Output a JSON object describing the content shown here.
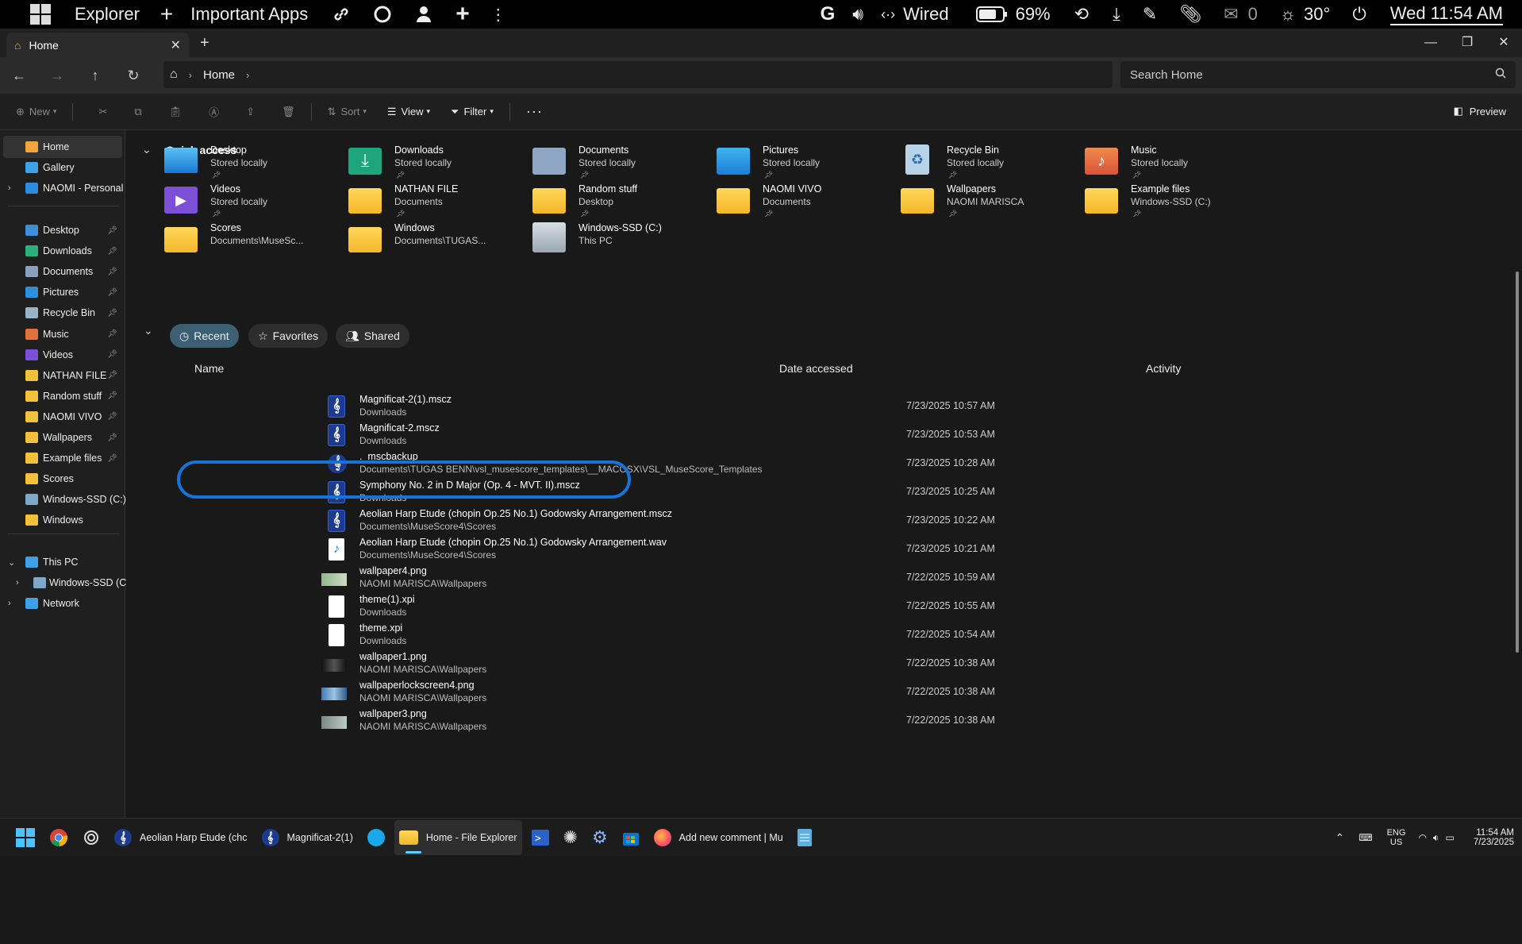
{
  "topbar": {
    "app_name": "Explorer",
    "pinned_label": "Important Apps",
    "network": "Wired",
    "battery": "69%",
    "mail_count": "0",
    "temperature": "30°",
    "clock": "Wed 11:54 AM"
  },
  "window": {
    "tab_title": "Home"
  },
  "address": {
    "crumb": "Home",
    "search_placeholder": "Search Home"
  },
  "toolbar": {
    "new": "New",
    "sort": "Sort",
    "view": "View",
    "filter": "Filter",
    "preview": "Preview"
  },
  "sidebar": {
    "top": [
      {
        "label": "Home"
      },
      {
        "label": "Gallery"
      },
      {
        "label": "NAOMI - Personal"
      }
    ],
    "pinned": [
      {
        "label": "Desktop",
        "color": "#3b8ed8"
      },
      {
        "label": "Downloads",
        "color": "#2bb07a"
      },
      {
        "label": "Documents",
        "color": "#8aa0c0"
      },
      {
        "label": "Pictures",
        "color": "#2c8fe0"
      },
      {
        "label": "Recycle Bin",
        "color": "#9ab3c8"
      },
      {
        "label": "Music",
        "color": "#e2703c"
      },
      {
        "label": "Videos",
        "color": "#7b4fd6"
      },
      {
        "label": "NATHAN FILE",
        "color": "#f3c03c"
      },
      {
        "label": "Random stuff",
        "color": "#f3c03c"
      },
      {
        "label": "NAOMI VIVO",
        "color": "#f3c03c"
      },
      {
        "label": "Wallpapers",
        "color": "#f3c03c"
      },
      {
        "label": "Example files",
        "color": "#f3c03c"
      },
      {
        "label": "Scores",
        "color": "#f3c03c"
      },
      {
        "label": "Windows-SSD (C:)",
        "color": "#7fa8c8"
      },
      {
        "label": "Windows",
        "color": "#f3c03c"
      }
    ],
    "bottom": [
      {
        "label": "This PC"
      },
      {
        "label": "Windows-SSD (C:)"
      },
      {
        "label": "Network"
      }
    ]
  },
  "quick_access": {
    "title": "Quick access",
    "items": [
      {
        "name": "Desktop",
        "sub": "Stored locally",
        "icon": "desktop-icon"
      },
      {
        "name": "Downloads",
        "sub": "Stored locally",
        "icon": "downloads-icon"
      },
      {
        "name": "Documents",
        "sub": "Stored locally",
        "icon": "documents-icon"
      },
      {
        "name": "Pictures",
        "sub": "Stored locally",
        "icon": "pictures-icon"
      },
      {
        "name": "Recycle Bin",
        "sub": "Stored locally",
        "icon": "recycle-bin-icon"
      },
      {
        "name": "Music",
        "sub": "Stored locally",
        "icon": "music-icon"
      },
      {
        "name": "Videos",
        "sub": "Stored locally",
        "icon": "videos-icon"
      },
      {
        "name": "NATHAN FILE",
        "sub": "Documents",
        "icon": "folder-icon"
      },
      {
        "name": "Random stuff",
        "sub": "Desktop",
        "icon": "folder-icon"
      },
      {
        "name": "NAOMI VIVO",
        "sub": "Documents",
        "icon": "folder-icon"
      },
      {
        "name": "Wallpapers",
        "sub": "NAOMI MARISCA",
        "icon": "folder-icon"
      },
      {
        "name": "Example files",
        "sub": "Windows-SSD (C:)",
        "icon": "folder-icon"
      },
      {
        "name": "Scores",
        "sub": "Documents\\MuseSc...",
        "icon": "folder-icon"
      },
      {
        "name": "Windows",
        "sub": "Documents\\TUGAS...",
        "icon": "folder-icon"
      },
      {
        "name": "Windows-SSD (C:)",
        "sub": "This PC",
        "icon": "drive-icon"
      }
    ]
  },
  "filters": {
    "recent": "Recent",
    "favorites": "Favorites",
    "shared": "Shared"
  },
  "columns": {
    "name": "Name",
    "date": "Date accessed",
    "activity": "Activity"
  },
  "files": [
    {
      "name": "Magnificat-2(1).mscz",
      "loc": "Downloads",
      "date": "7/23/2025 10:57 AM",
      "type": "mscz"
    },
    {
      "name": "Magnificat-2.mscz",
      "loc": "Downloads",
      "date": "7/23/2025 10:53 AM",
      "type": "mscz"
    },
    {
      "name": "._mscbackup",
      "loc": "Documents\\TUGAS BENN\\vsl_musescore_templates\\__MACOSX\\VSL_MuseScore_Templates",
      "date": "7/23/2025 10:28 AM",
      "type": "musescore"
    },
    {
      "name": "Symphony No. 2 in D Major (Op. 4 - MVT. II).mscz",
      "loc": "Downloads",
      "date": "7/23/2025 10:25 AM",
      "type": "mscz"
    },
    {
      "name": "Aeolian Harp Etude (chopin Op.25 No.1) Godowsky Arrangement.mscz",
      "loc": "Documents\\MuseScore4\\Scores",
      "date": "7/23/2025 10:22 AM",
      "type": "mscz"
    },
    {
      "name": "Aeolian Harp Etude (chopin Op.25 No.1) Godowsky Arrangement.wav",
      "loc": "Documents\\MuseScore4\\Scores",
      "date": "7/23/2025 10:21 AM",
      "type": "wav"
    },
    {
      "name": "wallpaper4.png",
      "loc": "NAOMI MARISCA\\Wallpapers",
      "date": "7/22/2025 10:59 AM",
      "type": "img-green"
    },
    {
      "name": "theme(1).xpi",
      "loc": "Downloads",
      "date": "7/22/2025 10:55 AM",
      "type": "doc"
    },
    {
      "name": "theme.xpi",
      "loc": "Downloads",
      "date": "7/22/2025 10:54 AM",
      "type": "doc"
    },
    {
      "name": "wallpaper1.png",
      "loc": "NAOMI MARISCA\\Wallpapers",
      "date": "7/22/2025 10:38 AM",
      "type": "img-dark"
    },
    {
      "name": "wallpaperlockscreen4.png",
      "loc": "NAOMI MARISCA\\Wallpapers",
      "date": "7/22/2025 10:38 AM",
      "type": "img-blue"
    },
    {
      "name": "wallpaper3.png",
      "loc": "NAOMI MARISCA\\Wallpapers",
      "date": "7/22/2025 10:38 AM",
      "type": "img-grey"
    }
  ],
  "taskbar": {
    "items": [
      {
        "label": "Aeolian Harp Etude (chc",
        "icon": "musescore-icon"
      },
      {
        "label": "Magnificat-2(1)",
        "icon": "musescore-icon"
      },
      {
        "label": "Home - File Explorer",
        "icon": "file-explorer-icon"
      },
      {
        "label": "Add new comment | Mu",
        "icon": "firefox-icon"
      }
    ],
    "lang": "ENG",
    "region": "US",
    "time": "11:54 AM",
    "date": "7/23/2025"
  },
  "colors": {
    "accent": "#60cdff",
    "annotation": "#1673d9",
    "folder": "#f3c03c"
  }
}
